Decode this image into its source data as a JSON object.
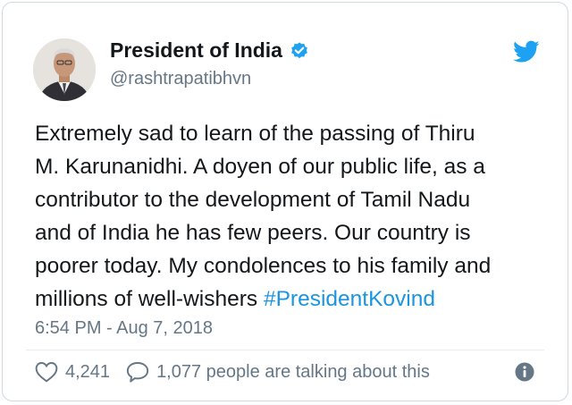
{
  "author": {
    "name": "President of India",
    "handle": "@rashtrapatibhvn",
    "verified": true
  },
  "tweet": {
    "lines": [
      "Extremely sad to learn of the passing of Thiru",
      "M. Karunanidhi. A doyen of our public life, as a",
      "contributor to the development of Tamil Nadu",
      "and of India he has few peers. Our country is",
      "poorer today. My condolences to his family and",
      "millions of well-wishers "
    ],
    "hashtag": "#PresidentKovind",
    "timestamp": "6:54 PM - Aug 7, 2018"
  },
  "engagement": {
    "likes": "4,241",
    "talking": "1,077 people are talking about this"
  },
  "colors": {
    "twitter_blue": "#1da1f2",
    "link_blue": "#1b95e0",
    "muted": "#657786",
    "text": "#14171a"
  },
  "icons": [
    "verified-badge-icon",
    "twitter-bird-icon",
    "heart-icon",
    "speech-bubble-icon",
    "info-icon"
  ]
}
